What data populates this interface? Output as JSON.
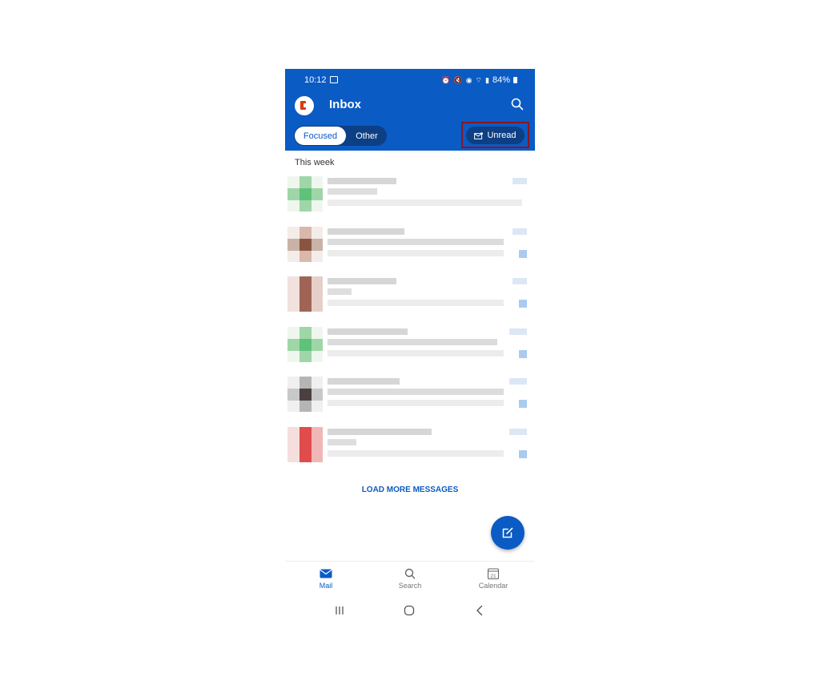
{
  "status_bar": {
    "time": "10:12",
    "battery": "84%"
  },
  "header": {
    "title": "Inbox",
    "tabs": [
      {
        "label": "Focused",
        "active": true
      },
      {
        "label": "Other",
        "active": false
      }
    ],
    "filter_button": {
      "label": "Unread"
    }
  },
  "list": {
    "section_label": "This week",
    "item_count": 6
  },
  "load_more_label": "LOAD MORE MESSAGES",
  "bottom_nav": {
    "items": [
      {
        "label": "Mail",
        "icon": "mail-icon",
        "active": true
      },
      {
        "label": "Search",
        "icon": "search-icon",
        "active": false
      },
      {
        "label": "Calendar",
        "icon": "calendar-icon",
        "active": false
      }
    ],
    "calendar_day": "21"
  },
  "colors": {
    "brand_blue": "#0a5bc4",
    "dark_pill": "#0d3f85",
    "highlight_border": "#8b1520"
  }
}
